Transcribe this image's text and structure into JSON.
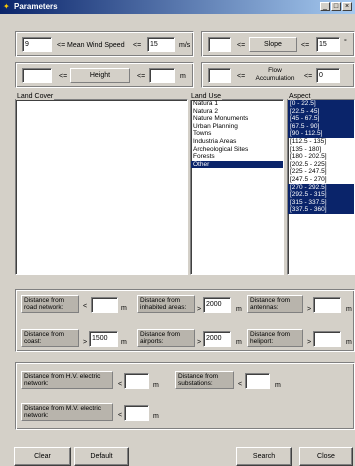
{
  "window": {
    "title": "Parameters",
    "min": "_",
    "max": "□",
    "close": "×"
  },
  "wind": {
    "min_value": "9",
    "lte1": "<=",
    "label": "Mean Wind Speed",
    "lte2": "<=",
    "max_value": "15",
    "unit": "m/s"
  },
  "slope": {
    "min_value": "",
    "lte1": "<=",
    "label": "Slope",
    "lte2": "<=",
    "max_value": "15",
    "unit": "°"
  },
  "height": {
    "min_value": "",
    "lte1": "<=",
    "label": "Height",
    "lte2": "<=",
    "max_value": "",
    "unit": "m"
  },
  "flow": {
    "min_value": "",
    "lte1": "<=",
    "label": "Flow Accumulation",
    "lte2": "<=",
    "max_value": "0"
  },
  "land_cover": {
    "label": "Land Cover",
    "items": []
  },
  "land_use": {
    "label": "Land Use",
    "items": [
      "Natura 1",
      "Natura 2",
      "Nature Monuments",
      "Urban Planning",
      "Towns",
      "Industria Areas",
      "Archeological Sites",
      "Forests",
      "Other"
    ],
    "selected": [
      8
    ]
  },
  "aspect": {
    "label": "Aspect",
    "items": [
      "[0 - 22.5]",
      "[22.5 - 45]",
      "[45 - 67.5]",
      "[67.5 - 90]",
      "[90 - 112.5]",
      "[112.5 - 135]",
      "[135 - 180]",
      "[180 - 202.5]",
      "[202.5 - 225]",
      "[225 - 247.5]",
      "[247.5 - 270]",
      "[270 - 292.5]",
      "[292.5 - 315]",
      "[315 - 337.5]",
      "[337.5 - 360]"
    ],
    "selected": [
      0,
      1,
      2,
      3,
      4,
      11,
      12,
      13,
      14
    ]
  },
  "distances": {
    "road": {
      "label": "Distance from road network:",
      "op": "<",
      "value": "",
      "unit": "m"
    },
    "inhabited": {
      "label": "Distance from inhabited areas:",
      "op": ">",
      "value": "2000",
      "unit": "m"
    },
    "antennas": {
      "label": "Distance from antennas:",
      "op": ">",
      "value": "",
      "unit": "m"
    },
    "coast": {
      "label": "Distance from coast:",
      "op": ">",
      "value": "1500",
      "unit": "m"
    },
    "airports": {
      "label": "Distance from airports:",
      "op": ">",
      "value": "2000",
      "unit": "m"
    },
    "heliport": {
      "label": "Distance from heliport:",
      "op": ">",
      "value": "",
      "unit": "m"
    },
    "hv": {
      "label": "Distance from H.V. electric network:",
      "op": "<",
      "value": "",
      "unit": "m"
    },
    "substations": {
      "label": "Distance from substations:",
      "op": "<",
      "value": "",
      "unit": "m"
    },
    "mv": {
      "label": "Distance from M.V. electric network:",
      "op": "<",
      "value": "",
      "unit": "m"
    }
  },
  "buttons": {
    "clear": "Clear",
    "default": "Default",
    "search": "Search",
    "close": "Close"
  }
}
